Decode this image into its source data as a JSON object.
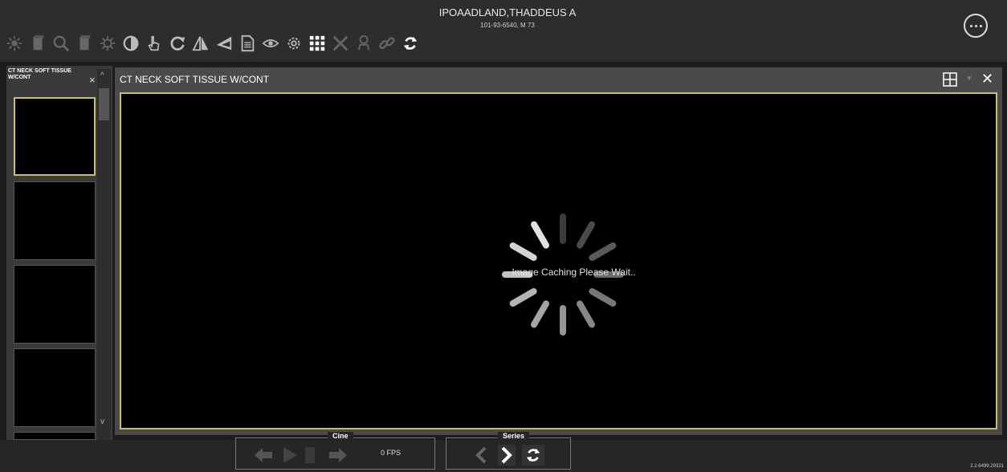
{
  "header": {
    "patient_name": "IPOAADLAND,THADDEUS A",
    "patient_details": "101-93-6540, M 73"
  },
  "toolbar": {
    "tools": [
      {
        "icon": "brightness-icon",
        "enabled": false
      },
      {
        "icon": "stack-icon",
        "enabled": false
      },
      {
        "icon": "zoom-icon",
        "enabled": false
      },
      {
        "icon": "stack2-icon",
        "enabled": false
      },
      {
        "icon": "invert-light-icon",
        "enabled": false
      },
      {
        "icon": "contrast-icon",
        "enabled": true
      },
      {
        "icon": "pan-hand-icon",
        "enabled": true
      },
      {
        "icon": "rotate-icon",
        "enabled": true
      },
      {
        "icon": "flip-icon",
        "enabled": true
      },
      {
        "icon": "angle-icon",
        "enabled": true
      },
      {
        "icon": "document-icon",
        "enabled": true
      },
      {
        "icon": "eye-icon",
        "enabled": true
      },
      {
        "icon": "settings-icon",
        "enabled": true
      },
      {
        "icon": "grid-icon",
        "enabled": true
      },
      {
        "icon": "tools-icon",
        "enabled": false
      },
      {
        "icon": "anatomy-icon",
        "enabled": false
      },
      {
        "icon": "link-icon",
        "enabled": false
      },
      {
        "icon": "sync-icon",
        "enabled": true
      }
    ]
  },
  "series_panel": {
    "title": "CT NECK SOFT TISSUE W/CONT",
    "close": "×",
    "scroll_up": "^",
    "scroll_down": "v"
  },
  "viewer": {
    "title": "CT NECK SOFT TISSUE W/CONT",
    "close": "✕",
    "caret": "▼",
    "loading_text": "Image Caching Please Wait.."
  },
  "controls": {
    "cine_label": "Cine",
    "fps": "0 FPS",
    "series_label": "Series"
  },
  "footer": {
    "version": "2.2.6499.29321"
  },
  "colors": {
    "accent_border": "#c8c16a",
    "background": "#1d1d1d",
    "toolbar_bg": "#2d2d2d"
  }
}
